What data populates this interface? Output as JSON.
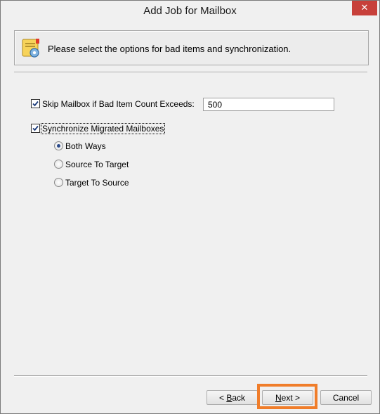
{
  "window": {
    "title": "Add Job for Mailbox",
    "close_glyph": "✕"
  },
  "header": {
    "icon": "settings-note-icon",
    "text": "Please select the options for bad items and synchronization."
  },
  "options": {
    "skip_mailbox": {
      "label": "Skip Mailbox if Bad Item Count Exceeds:",
      "checked": true,
      "count_value": "500"
    },
    "synchronize": {
      "label": "Synchronize Migrated Mailboxes",
      "checked": true
    },
    "sync_direction": [
      {
        "label": "Both Ways",
        "selected": true
      },
      {
        "label": "Source To Target",
        "selected": false
      },
      {
        "label": "Target To Source",
        "selected": false
      }
    ]
  },
  "buttons": {
    "back": {
      "prefix": "< ",
      "mnemonic": "B",
      "rest": "ack"
    },
    "next": {
      "mnemonic": "N",
      "rest": "ext >"
    },
    "cancel": {
      "label": "Cancel"
    }
  },
  "colors": {
    "highlight": "#f07d2a",
    "close": "#c7403a"
  }
}
